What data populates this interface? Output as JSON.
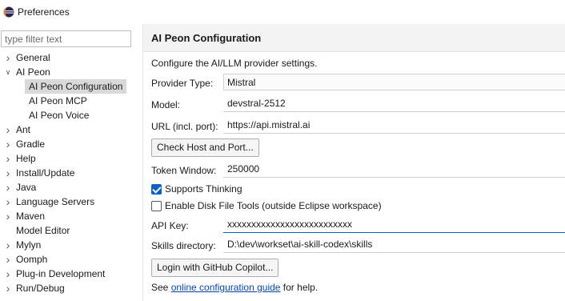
{
  "window": {
    "title": "Preferences",
    "accent_color": "#0a64c8"
  },
  "left": {
    "filter_placeholder": "type filter text",
    "tree": [
      {
        "label": "General",
        "expander": "collapsed"
      },
      {
        "label": "AI Peon",
        "expander": "expanded"
      },
      {
        "label": "AI Peon Configuration",
        "child": true,
        "selected": true
      },
      {
        "label": "AI Peon MCP",
        "child": true
      },
      {
        "label": "AI Peon Voice",
        "child": true
      },
      {
        "label": "Ant",
        "expander": "collapsed"
      },
      {
        "label": "Gradle",
        "expander": "collapsed"
      },
      {
        "label": "Help",
        "expander": "collapsed"
      },
      {
        "label": "Install/Update",
        "expander": "collapsed"
      },
      {
        "label": "Java",
        "expander": "collapsed"
      },
      {
        "label": "Language Servers",
        "expander": "collapsed"
      },
      {
        "label": "Maven",
        "expander": "collapsed"
      },
      {
        "label": "Model Editor"
      },
      {
        "label": "Mylyn",
        "expander": "collapsed"
      },
      {
        "label": "Oomph",
        "expander": "collapsed"
      },
      {
        "label": "Plug-in Development",
        "expander": "collapsed"
      },
      {
        "label": "Run/Debug",
        "expander": "collapsed"
      }
    ]
  },
  "page": {
    "title": "AI Peon Configuration",
    "description": "Configure the AI/LLM provider settings.",
    "provider_type": {
      "label": "Provider Type:",
      "value": "Mistral"
    },
    "model": {
      "label": "Model:",
      "value": "devstral-2512"
    },
    "url": {
      "label": "URL (incl. port):",
      "value": "https://api.mistral.ai"
    },
    "check_host_button": "Check Host and Port...",
    "token_window": {
      "label": "Token Window:",
      "value": "250000"
    },
    "supports_thinking": {
      "label": "Supports Thinking",
      "checked": true
    },
    "enable_disk_tools": {
      "label": "Enable Disk File Tools (outside Eclipse workspace)",
      "checked": false
    },
    "api_key": {
      "label": "API Key:",
      "value": "xxxxxxxxxxxxxxxxxxxxxxxxxx"
    },
    "skills_directory": {
      "label": "Skills directory:",
      "value": "D:\\dev\\workset\\ai-skill-codex\\skills"
    },
    "login_button": "Login with GitHub Copilot...",
    "help": {
      "prefix": "See ",
      "link": "online configuration guide",
      "suffix": " for help."
    }
  }
}
